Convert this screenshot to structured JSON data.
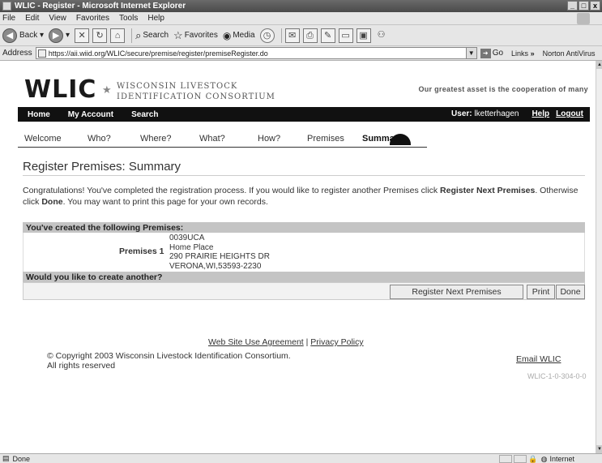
{
  "window": {
    "title": "WLIC - Register - Microsoft Internet Explorer",
    "minimize": "_",
    "maximize": "□",
    "close": "x"
  },
  "menu": [
    "File",
    "Edit",
    "View",
    "Favorites",
    "Tools",
    "Help"
  ],
  "toolbar": {
    "back_label": "Back",
    "search_label": "Search",
    "favorites_label": "Favorites",
    "media_label": "Media"
  },
  "address": {
    "label": "Address",
    "url": "https://aii.wiid.org/WLIC/secure/premise/register/premiseRegister.do",
    "go_label": "Go",
    "links_label": "Links",
    "links_chevron": "»",
    "norton_label": "Norton AntiVirus"
  },
  "site": {
    "logo": "WLIC",
    "logo_line1": "WISCONSIN LIVESTOCK",
    "logo_line2": "IDENTIFICATION CONSORTIUM",
    "tagline": "Our greatest asset is the cooperation of many"
  },
  "nav": {
    "home": "Home",
    "my_account": "My Account",
    "search": "Search",
    "user_label": "User:",
    "user_name": "lketterhagen",
    "help": "Help",
    "logout": "Logout"
  },
  "steps": [
    "Welcome",
    "Who?",
    "Where?",
    "What?",
    "How?",
    "Premises",
    "Summary"
  ],
  "active_step": "Summary",
  "content": {
    "title": "Register Premises: Summary",
    "intro_1": "Congratulations! You've completed the registration process. If you would like to register another Premises click ",
    "intro_bold_1": "Register Next Premises",
    "intro_2": ". Otherwise click ",
    "intro_bold_2": "Done",
    "intro_3": ". You may want to print this page for your own records.",
    "created_header": "You've created the following Premises:",
    "premises_label": "Premises 1",
    "premises_address": [
      "0039UCA",
      "Home Place",
      "290 PRAIRIE HEIGHTS DR",
      "VERONA,WI,53593-2230"
    ],
    "another_header": "Would you like to create another?",
    "btn_next": "Register Next Premises",
    "btn_print": "Print",
    "btn_done": "Done"
  },
  "footer": {
    "agreement": "Web Site Use Agreement",
    "separator": "|",
    "privacy": "Privacy Policy",
    "copyright_1": "© Copyright 2003 Wisconsin Livestock Identification Consortium.",
    "copyright_2": "All rights reserved",
    "email": "Email WLIC",
    "version": "WLIC-1-0-304-0-0"
  },
  "status": {
    "text": "Done",
    "zone": "Internet"
  }
}
